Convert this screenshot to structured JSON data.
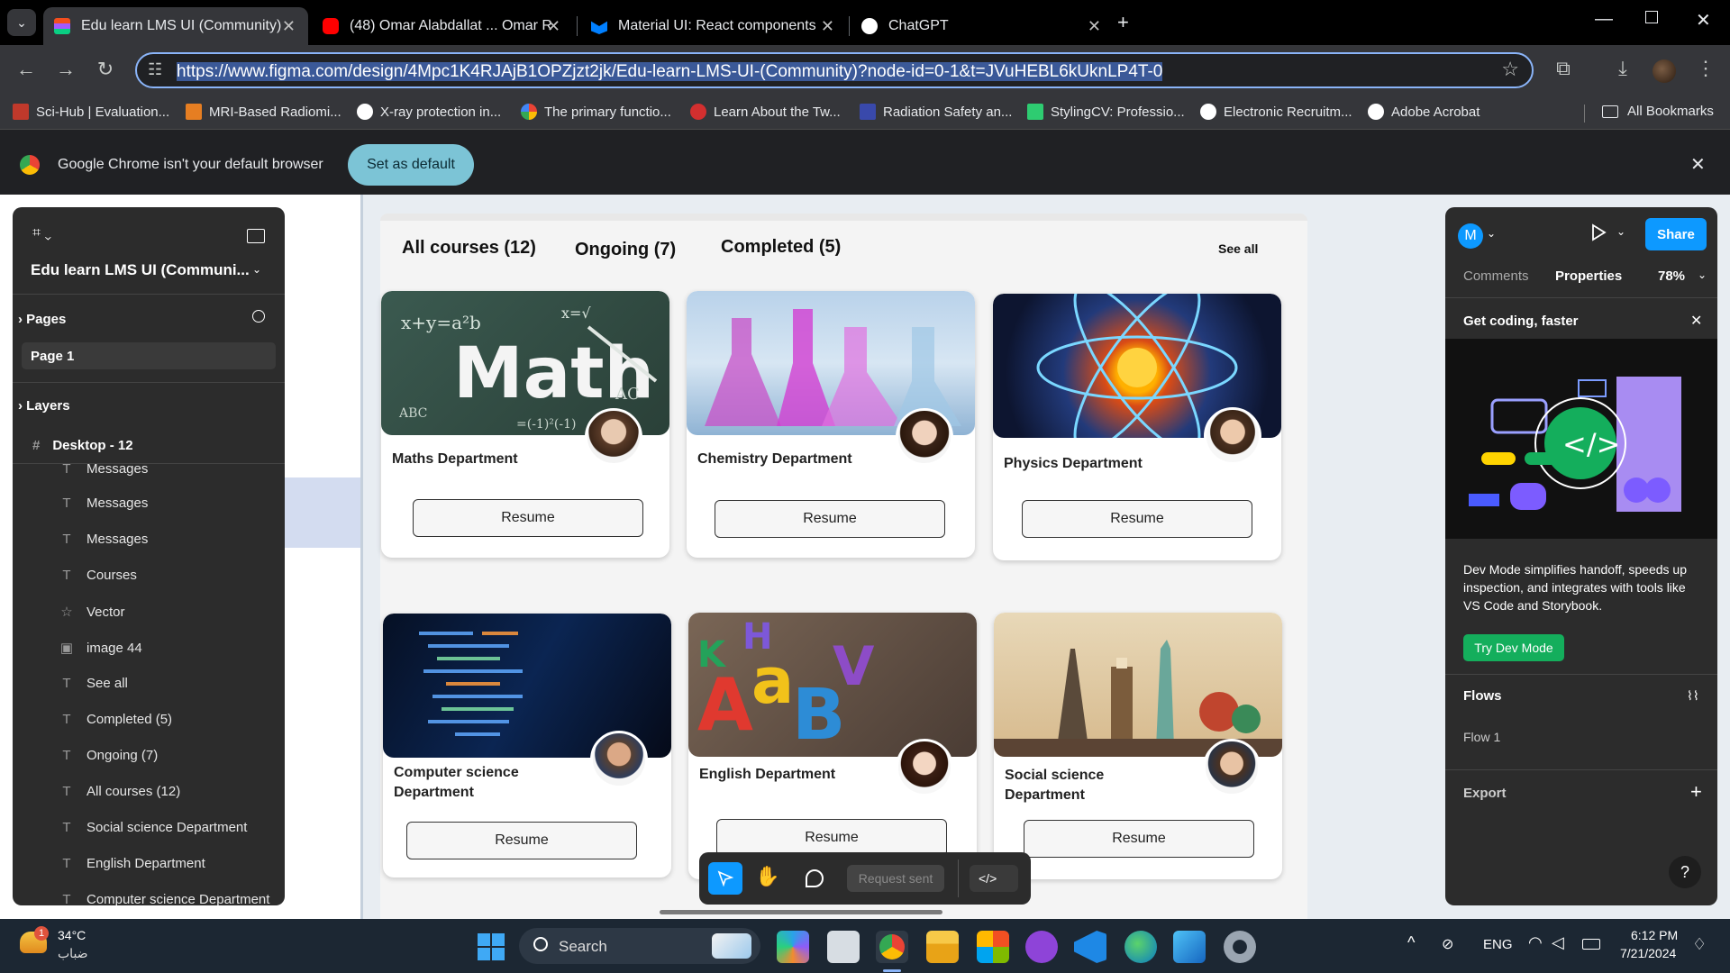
{
  "tabs": [
    {
      "label": "Edu learn LMS UI (Community)",
      "icon_color": "#f24e1e"
    },
    {
      "label": "(48) Omar Alabdallat ... Omar R",
      "icon_color": "#ff0000"
    },
    {
      "label": "Material UI: React components",
      "icon_color": "#007fff"
    },
    {
      "label": "ChatGPT",
      "icon_color": "#ffffff"
    }
  ],
  "address": {
    "url": "https://www.figma.com/design/4Mpc1K4RJAjB1OPZjzt2jk/Edu-learn-LMS-UI-(Community)?node-id=0-1&t=JVuHEBL6kUknLP4T-0"
  },
  "bookmarks": [
    {
      "label": "Sci-Hub | Evaluation...",
      "color": "#c0392b"
    },
    {
      "label": "MRI-Based Radiomi...",
      "color": "#e67e22"
    },
    {
      "label": "X-ray protection in...",
      "color": "#ffffff"
    },
    {
      "label": "The primary functio...",
      "color": "#4285f4"
    },
    {
      "label": "Learn About the Tw...",
      "color": "#d32f2f"
    },
    {
      "label": "Radiation Safety an...",
      "color": "#3949ab"
    },
    {
      "label": "StylingCV: Professio...",
      "color": "#2ecc71"
    },
    {
      "label": "Electronic Recruitm...",
      "color": "#ffffff"
    },
    {
      "label": "Adobe Acrobat",
      "color": "#ffffff"
    }
  ],
  "all_bookmarks": "All Bookmarks",
  "infobar": {
    "message": "Google Chrome isn't your default browser",
    "button": "Set as default"
  },
  "figma_left": {
    "file_name": "Edu learn LMS UI (Communi...",
    "pages_heading": "Pages",
    "page_item": "Page 1",
    "layers_heading": "Layers",
    "frame_name": "Desktop - 12",
    "layers": [
      {
        "icon": "T",
        "label": "Messages"
      },
      {
        "icon": "T",
        "label": "Messages"
      },
      {
        "icon": "T",
        "label": "Messages"
      },
      {
        "icon": "T",
        "label": "Courses"
      },
      {
        "icon": "☆",
        "label": "Vector"
      },
      {
        "icon": "▣",
        "label": "image 44"
      },
      {
        "icon": "T",
        "label": "See all"
      },
      {
        "icon": "T",
        "label": "Completed (5)"
      },
      {
        "icon": "T",
        "label": "Ongoing (7)"
      },
      {
        "icon": "T",
        "label": "All courses (12)"
      },
      {
        "icon": "T",
        "label": "Social science Department"
      },
      {
        "icon": "T",
        "label": "English Department"
      },
      {
        "icon": "T",
        "label": "Computer science Department"
      }
    ]
  },
  "frame": {
    "tabs": [
      "All courses (12)",
      "Ongoing (7)",
      "Completed (5)"
    ],
    "see_all": "See all",
    "resume_label": "Resume",
    "cards": [
      {
        "dept": "Maths Department"
      },
      {
        "dept": "Chemistry Department"
      },
      {
        "dept": "Physics Department"
      },
      {
        "dept": "Computer science Department"
      },
      {
        "dept": "English Department"
      },
      {
        "dept": "Social science Department"
      }
    ]
  },
  "toolbar_bottom": {
    "request": "Request sent"
  },
  "figma_right": {
    "avatar_letter": "M",
    "share": "Share",
    "tab_comments": "Comments",
    "tab_properties": "Properties",
    "zoom": "78%",
    "promo_title": "Get coding, faster",
    "promo_text": "Dev Mode simplifies handoff, speeds up inspection, and integrates with tools like VS Code and Storybook.",
    "promo_button": "Try Dev Mode",
    "flows_heading": "Flows",
    "flow_item": "Flow 1",
    "export_heading": "Export"
  },
  "taskbar": {
    "temp": "34°C",
    "weather_text": "ضباب",
    "search": "Search",
    "lang": "ENG",
    "time": "6:12 PM",
    "date": "7/21/2024",
    "weather_badge": "1"
  },
  "colors": {
    "accent": "#0d99ff",
    "devmode_green": "#14ae5c",
    "setdefault": "#7cc4d6"
  }
}
